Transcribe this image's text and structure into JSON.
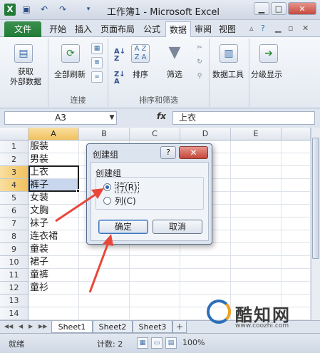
{
  "window": {
    "title": "工作簿1 - Microsoft Excel",
    "qat_icons": [
      "excel-app-icon",
      "save-icon",
      "undo-icon",
      "redo-icon",
      "customize-qat-icon"
    ],
    "controls": [
      "minimize",
      "maximize",
      "close"
    ]
  },
  "tabs": {
    "file": "文件",
    "items": [
      "开始",
      "插入",
      "页面布局",
      "公式",
      "数据",
      "审阅",
      "视图"
    ],
    "active": "数据"
  },
  "ribbon": {
    "get_external": "获取\n外部数据",
    "refresh_all": "全部刷新",
    "group_connect": "连接",
    "sort": "排序",
    "filter": "筛选",
    "group_sort_filter": "排序和筛选",
    "data_tools": "数据工具",
    "outline": "分级显示"
  },
  "formula_bar": {
    "name_box": "A3",
    "fx": "fx",
    "value": "上衣"
  },
  "sheet": {
    "columns": [
      "A",
      "B",
      "C",
      "D",
      "E"
    ],
    "selected_column": "A",
    "rows": [
      "1",
      "2",
      "3",
      "4",
      "5",
      "6",
      "7",
      "8",
      "9",
      "10",
      "11",
      "12",
      "13",
      "14"
    ],
    "selected_rows": [
      "3",
      "4"
    ],
    "col_a_values": [
      "服装",
      "男装",
      "上衣",
      "裤子",
      "女装",
      "文胸",
      "袜子",
      "连衣裙",
      "童装",
      "裙子",
      "童裤",
      "童衫",
      "",
      ""
    ]
  },
  "sheet_tabs": [
    "Sheet1",
    "Sheet2",
    "Sheet3"
  ],
  "active_sheet": "Sheet1",
  "status": {
    "mode": "就绪",
    "count": "计数: 2",
    "zoom": "100%"
  },
  "dialog": {
    "title": "创建组",
    "help": "?",
    "close": "✕",
    "group_label": "创建组",
    "option_row": "行(R)",
    "option_col": "列(C)",
    "ok": "确定",
    "cancel": "取消"
  },
  "watermark": {
    "text": "酷知网",
    "url": "www.coozhi.com"
  },
  "colors": {
    "file_tab": "#217b37",
    "selection": "#c8d7ed",
    "arrow": "#e8473a",
    "header_highlight": "#f1c15d"
  }
}
